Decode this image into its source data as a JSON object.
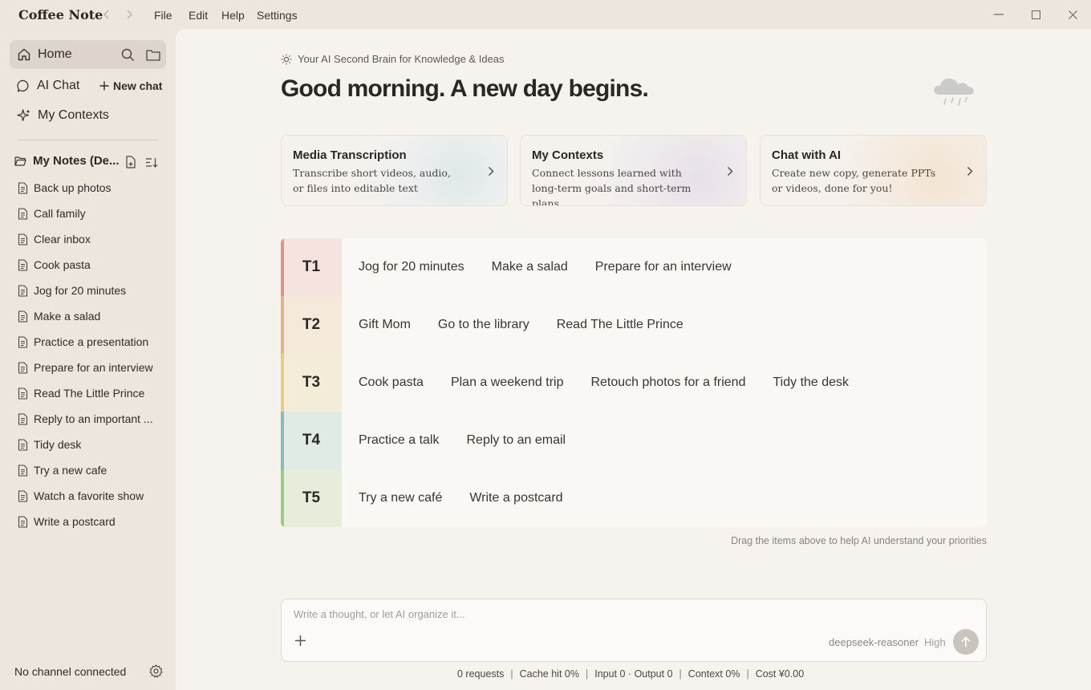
{
  "app": {
    "title": "Coffee Note"
  },
  "menu": {
    "file": "File",
    "edit": "Edit",
    "help": "Help",
    "settings": "Settings"
  },
  "sidebar": {
    "home": "Home",
    "ai_chat": "AI Chat",
    "new_chat": "New chat",
    "my_contexts": "My Contexts",
    "notes_folder": "My Notes (De...",
    "notes": [
      "Back up photos",
      "Call family",
      "Clear inbox",
      "Cook pasta",
      "Jog for 20 minutes",
      "Make a salad",
      "Practice a presentation",
      "Prepare for an interview",
      "Read The Little Prince",
      "Reply to an important ...",
      "Tidy desk",
      "Try a new cafe",
      "Watch a favorite show",
      "Write a postcard"
    ],
    "status": "No channel connected"
  },
  "main": {
    "tagline": "Your AI Second Brain for Knowledge & Ideas",
    "greeting": "Good morning. A new day begins.",
    "cards": [
      {
        "title": "Media Transcription",
        "desc": "Transcribe short videos, audio, or files into editable text"
      },
      {
        "title": "My Contexts",
        "desc": "Connect lessons learned with long-term goals and short-term plans"
      },
      {
        "title": "Chat with AI",
        "desc": "Create new copy, generate PPTs or videos, done for you!"
      }
    ],
    "tiers": [
      {
        "label": "T1",
        "color": "#e58f8f",
        "bg": "#f5e3df",
        "items": [
          "Jog for 20 minutes",
          "Make a salad",
          "Prepare for an interview"
        ]
      },
      {
        "label": "T2",
        "color": "#e9b27a",
        "bg": "#f5e9dc",
        "items": [
          "Gift Mom",
          "Go to the library",
          "Read The Little Prince"
        ]
      },
      {
        "label": "T3",
        "color": "#e5cf7a",
        "bg": "#f3ecd9",
        "items": [
          "Cook pasta",
          "Plan a weekend trip",
          "Retouch photos for a friend",
          "Tidy the desk"
        ]
      },
      {
        "label": "T4",
        "color": "#7cc2b6",
        "bg": "#e0ebe5",
        "items": [
          "Practice a talk",
          "Reply to an email"
        ]
      },
      {
        "label": "T5",
        "color": "#9ccb7e",
        "bg": "#e6edda",
        "items": [
          "Try a new café",
          "Write a postcard"
        ]
      }
    ],
    "hint": "Drag the items above to help AI understand your priorities",
    "composer": {
      "placeholder": "Write a thought, or let AI organize it...",
      "model": "deepseek-reasoner",
      "effort": "High"
    },
    "stats": {
      "requests": "0 requests",
      "cache_label": "Cache hit",
      "cache_value": "0%",
      "io": "Input 0 · Output 0",
      "context_label": "Context",
      "context_value": "0%",
      "cost_label": "Cost",
      "cost_value": "¥0.00"
    }
  }
}
